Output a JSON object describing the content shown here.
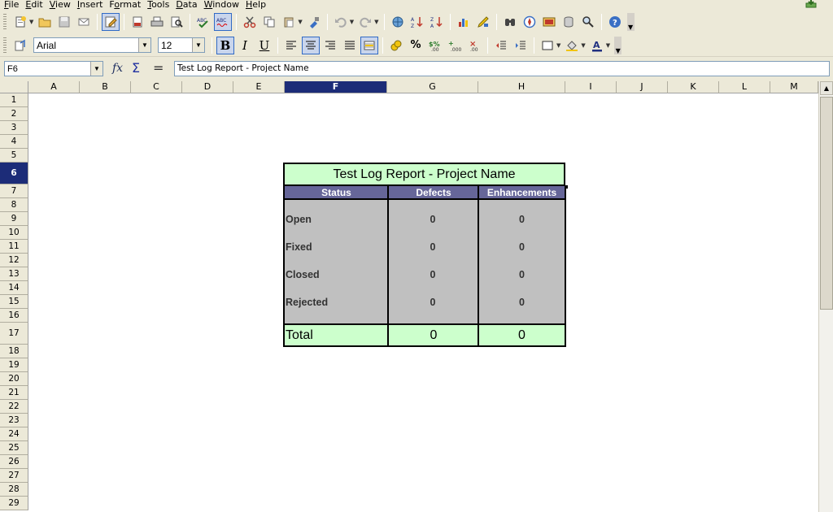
{
  "menu": [
    "File",
    "Edit",
    "View",
    "Insert",
    "Format",
    "Tools",
    "Data",
    "Window",
    "Help"
  ],
  "menu_mnemonic": [
    "F",
    "E",
    "V",
    "I",
    "o",
    "T",
    "D",
    "W",
    "H"
  ],
  "formatting": {
    "font_name": "Arial",
    "font_size": "12"
  },
  "formula_bar": {
    "name_box": "F6",
    "content": "Test Log Report - Project Name"
  },
  "columns": [
    "A",
    "B",
    "C",
    "D",
    "E",
    "F",
    "G",
    "H",
    "I",
    "J",
    "K",
    "L",
    "M"
  ],
  "selected_column": "F",
  "rows": [
    "1",
    "2",
    "3",
    "4",
    "5",
    "6",
    "7",
    "8",
    "9",
    "10",
    "11",
    "12",
    "13",
    "14",
    "15",
    "16",
    "17",
    "18",
    "19",
    "20",
    "21",
    "22",
    "23",
    "24",
    "25",
    "26",
    "27",
    "28",
    "29"
  ],
  "selected_row": "6",
  "report": {
    "title": "Test Log Report - Project Name",
    "headers": [
      "Status",
      "Defects",
      "Enhancements"
    ],
    "rows": [
      {
        "status": "Open",
        "defects": "0",
        "enhancements": "0"
      },
      {
        "status": "Fixed",
        "defects": "0",
        "enhancements": "0"
      },
      {
        "status": "Closed",
        "defects": "0",
        "enhancements": "0"
      },
      {
        "status": "Rejected",
        "defects": "0",
        "enhancements": "0"
      }
    ],
    "total": {
      "label": "Total",
      "defects": "0",
      "enhancements": "0"
    }
  },
  "colors": {
    "title_bg": "#ccffcc",
    "header_bg": "#666699",
    "body_bg": "#c0c0c0",
    "selected_header": "#1c2c78"
  }
}
